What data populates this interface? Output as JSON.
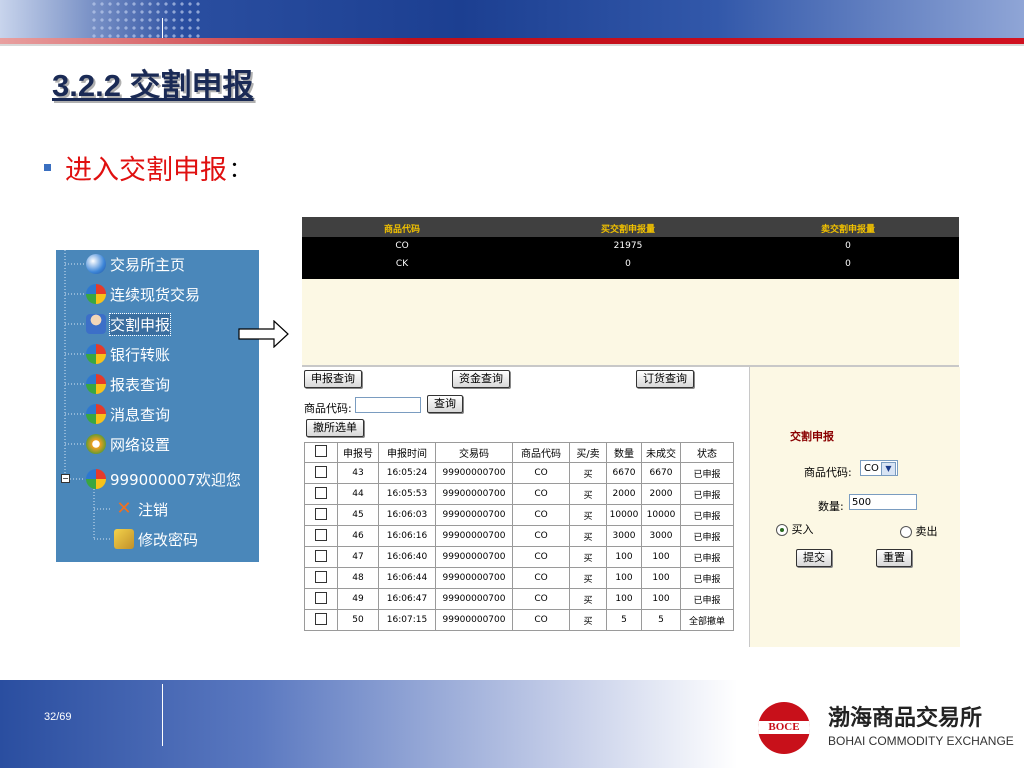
{
  "slide": {
    "title": "3.2.2 交割申报",
    "bullet": "进入交割申报",
    "bullet_colon": "：",
    "page_number": "32/69"
  },
  "logo": {
    "badge": "BOCE",
    "name_cn": "渤海商品交易所",
    "name_en": "BOHAI COMMODITY EXCHANGE",
    "brand_color": "#c8101a"
  },
  "tree": {
    "items": [
      {
        "label": "交易所主页",
        "icon": "globe-icon"
      },
      {
        "label": "连续现货交易",
        "icon": "colorful-ball-icon"
      },
      {
        "label": "交割申报",
        "icon": "user-computer-icon",
        "selected": true
      },
      {
        "label": "银行转账",
        "icon": "colorful-ball-icon"
      },
      {
        "label": "报表查询",
        "icon": "colorful-ball-icon"
      },
      {
        "label": "消息查询",
        "icon": "colorful-ball-icon"
      },
      {
        "label": "网络设置",
        "icon": "network-gear-icon"
      },
      {
        "label": "999000007欢迎您",
        "icon": "colorful-ball-icon"
      },
      {
        "label": "注销",
        "icon": "logout-icon"
      },
      {
        "label": "修改密码",
        "icon": "password-key-icon"
      }
    ]
  },
  "summary_grid": {
    "headers": [
      "商品代码",
      "买交割申报量",
      "卖交割申报量"
    ],
    "rows": [
      [
        "CO",
        "21975",
        "0"
      ],
      [
        "CK",
        "0",
        "0"
      ]
    ]
  },
  "query": {
    "tabs": [
      "申报查询",
      "资金查询",
      "订货查询"
    ],
    "commodity_label": "商品代码:",
    "commodity_value": "",
    "query_button": "查询",
    "cancel_selected_button": "撤所选单"
  },
  "orders": {
    "columns": [
      "申报号",
      "申报时间",
      "交易码",
      "商品代码",
      "买/卖",
      "数量",
      "未成交",
      "状态"
    ],
    "rows": [
      [
        "43",
        "16:05:24",
        "99900000700",
        "CO",
        "买",
        "6670",
        "6670",
        "已申报"
      ],
      [
        "44",
        "16:05:53",
        "99900000700",
        "CO",
        "买",
        "2000",
        "2000",
        "已申报"
      ],
      [
        "45",
        "16:06:03",
        "99900000700",
        "CO",
        "买",
        "10000",
        "10000",
        "已申报"
      ],
      [
        "46",
        "16:06:16",
        "99900000700",
        "CO",
        "买",
        "3000",
        "3000",
        "已申报"
      ],
      [
        "47",
        "16:06:40",
        "99900000700",
        "CO",
        "买",
        "100",
        "100",
        "已申报"
      ],
      [
        "48",
        "16:06:44",
        "99900000700",
        "CO",
        "买",
        "100",
        "100",
        "已申报"
      ],
      [
        "49",
        "16:06:47",
        "99900000700",
        "CO",
        "买",
        "100",
        "100",
        "已申报"
      ],
      [
        "50",
        "16:07:15",
        "99900000700",
        "CO",
        "买",
        "5",
        "5",
        "全部撤单"
      ]
    ]
  },
  "delivery_form": {
    "title": "交割申报",
    "commodity_label": "商品代码:",
    "commodity_value": "CO",
    "quantity_label": "数量:",
    "quantity_value": "500",
    "buy_label": "买入",
    "sell_label": "卖出",
    "selected_side": "买入",
    "submit_button": "提交",
    "reset_button": "重置"
  }
}
